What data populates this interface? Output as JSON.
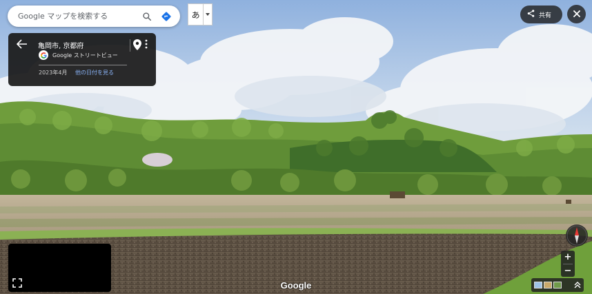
{
  "search": {
    "placeholder": "Google マップを検索する",
    "search_icon": "search-icon",
    "directions_icon": "directions-icon"
  },
  "input_tool": {
    "label": "あ",
    "arrow_icon": "dropdown-arrow-icon"
  },
  "info_card": {
    "title": "亀岡市, 京都府",
    "provider": "Google ストリートビュー",
    "capture_date": "2023年4月",
    "other_dates_link": "他の日付を見る"
  },
  "toolbar": {
    "share_label": "共有",
    "share_icon": "share-icon",
    "close_icon": "close-icon"
  },
  "zoom": {
    "in_label": "+",
    "out_label": "−"
  },
  "watermark": "Google",
  "colors": {
    "blue_link": "#8ab4f8",
    "directions_blue": "#1a73e8",
    "compass_red": "#e53935",
    "panel_dark": "#1a1a1a"
  }
}
